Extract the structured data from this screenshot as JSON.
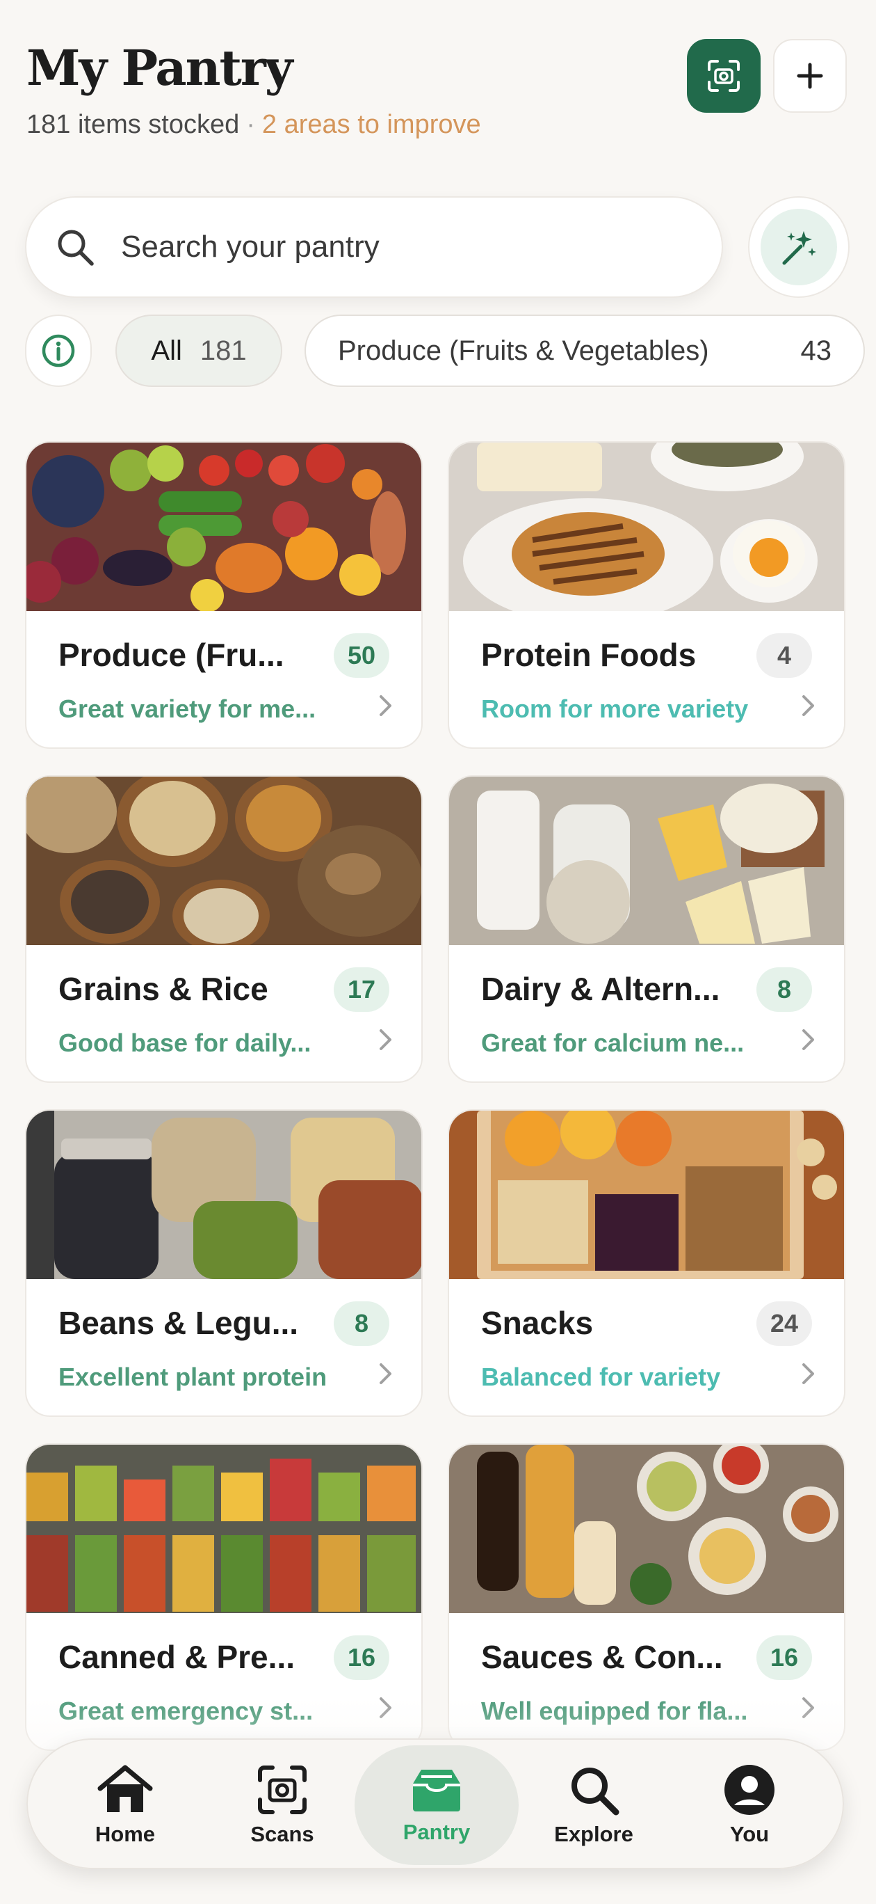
{
  "header": {
    "title": "My Pantry",
    "items_stocked": "181 items stocked",
    "separator": "·",
    "improve": "2 areas to improve"
  },
  "search": {
    "placeholder": "Search your pantry"
  },
  "filters": {
    "all_label": "All",
    "all_count": "181",
    "produce_label": "Produce (Fruits & Vegetables)",
    "produce_count": "43"
  },
  "categories": [
    {
      "name": "Produce (Fru...",
      "count": "50",
      "note": "Great variety for me...",
      "badge_style": "green",
      "note_style": "green"
    },
    {
      "name": "Protein Foods",
      "count": "4",
      "note": "Room for more variety",
      "badge_style": "gray",
      "note_style": "teal"
    },
    {
      "name": "Grains & Rice",
      "count": "17",
      "note": "Good base for daily...",
      "badge_style": "green",
      "note_style": "green"
    },
    {
      "name": "Dairy & Altern...",
      "count": "8",
      "note": "Great for calcium ne...",
      "badge_style": "green",
      "note_style": "green"
    },
    {
      "name": "Beans & Legu...",
      "count": "8",
      "note": "Excellent plant protein",
      "badge_style": "green",
      "note_style": "green"
    },
    {
      "name": "Snacks",
      "count": "24",
      "note": "Balanced for variety",
      "badge_style": "gray",
      "note_style": "teal"
    },
    {
      "name": "Canned & Pre...",
      "count": "16",
      "note": "Great emergency st...",
      "badge_style": "green",
      "note_style": "green"
    },
    {
      "name": "Sauces & Con...",
      "count": "16",
      "note": "Well equipped for fla...",
      "badge_style": "green",
      "note_style": "green"
    }
  ],
  "tabs": [
    {
      "label": "Home",
      "icon": "home-icon"
    },
    {
      "label": "Scans",
      "icon": "scan-icon"
    },
    {
      "label": "Pantry",
      "icon": "pantry-icon",
      "active": true
    },
    {
      "label": "Explore",
      "icon": "search-icon"
    },
    {
      "label": "You",
      "icon": "profile-icon"
    }
  ],
  "colors": {
    "brand_green": "#216a4b",
    "accent_orange": "#d4955a",
    "note_green": "#4f9b7b",
    "note_teal": "#4dbcb1",
    "active_tab": "#2fa56a"
  }
}
